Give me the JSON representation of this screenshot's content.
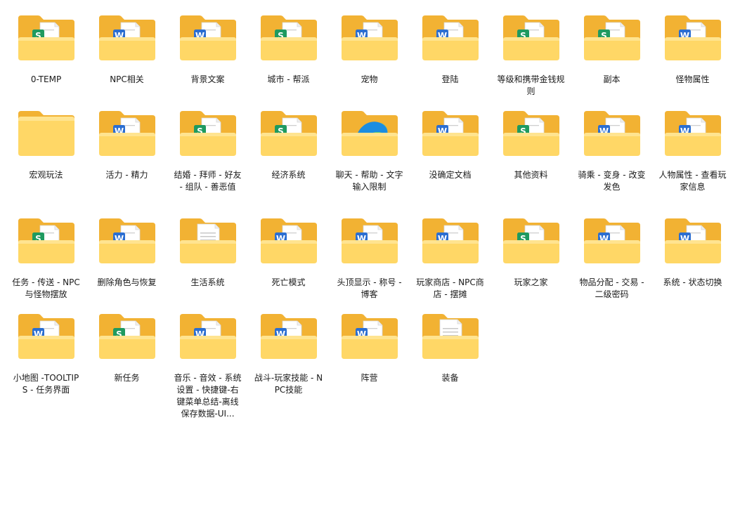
{
  "folders": [
    {
      "name": "0-TEMP",
      "doc": "sheet"
    },
    {
      "name": "NPC相关",
      "doc": "word"
    },
    {
      "name": "背景文案",
      "doc": "word"
    },
    {
      "name": "城市 - 帮派",
      "doc": "sheet"
    },
    {
      "name": "宠物",
      "doc": "word"
    },
    {
      "name": "登陆",
      "doc": "word"
    },
    {
      "name": "等级和携带金钱规则",
      "doc": "sheet"
    },
    {
      "name": "副本",
      "doc": "sheet"
    },
    {
      "name": "怪物属性",
      "doc": "word"
    },
    {
      "name": "宏观玩法",
      "doc": "empty"
    },
    {
      "name": "活力 - 精力",
      "doc": "word"
    },
    {
      "name": "结婚 - 拜师 - 好友 - 组队 - 善恶值",
      "doc": "sheet"
    },
    {
      "name": "经济系统",
      "doc": "sheet"
    },
    {
      "name": "聊天 - 帮助 - 文字输入限制",
      "doc": "edge"
    },
    {
      "name": "没确定文档",
      "doc": "word"
    },
    {
      "name": "其他资料",
      "doc": "sheet"
    },
    {
      "name": "骑乘 - 变身 - 改变发色",
      "doc": "word"
    },
    {
      "name": "人物属性 - 查看玩家信息",
      "doc": "word"
    },
    {
      "name": "任务 - 传送 - NPC与怪物摆放",
      "doc": "sheet"
    },
    {
      "name": "删除角色与恢复",
      "doc": "word"
    },
    {
      "name": "生活系统",
      "doc": "text"
    },
    {
      "name": "死亡模式",
      "doc": "word"
    },
    {
      "name": "头顶显示 - 称号 - 博客",
      "doc": "word"
    },
    {
      "name": "玩家商店 - NPC商店 - 摆摊",
      "doc": "word"
    },
    {
      "name": "玩家之家",
      "doc": "sheet"
    },
    {
      "name": "物品分配 - 交易 - 二级密码",
      "doc": "word"
    },
    {
      "name": "系统 - 状态切换",
      "doc": "word"
    },
    {
      "name": "小地图 -TOOLTIPS - 任务界面",
      "doc": "word"
    },
    {
      "name": "新任务",
      "doc": "sheet"
    },
    {
      "name": "音乐 - 音效 - 系统设置 - 快捷键-右键菜单总结-离线保存数据-UI...",
      "doc": "word"
    },
    {
      "name": "战斗-玩家技能 - NPC技能",
      "doc": "word"
    },
    {
      "name": "阵营",
      "doc": "word"
    },
    {
      "name": "装备",
      "doc": "text"
    }
  ],
  "doc_badges": {
    "word": "W",
    "sheet": "S"
  },
  "colors": {
    "folder_back": "#f2b233",
    "folder_front": "#ffd766",
    "folder_front_dark": "#f8c544",
    "word_blue": "#2b6ed1",
    "sheet_green": "#1f9a60"
  }
}
